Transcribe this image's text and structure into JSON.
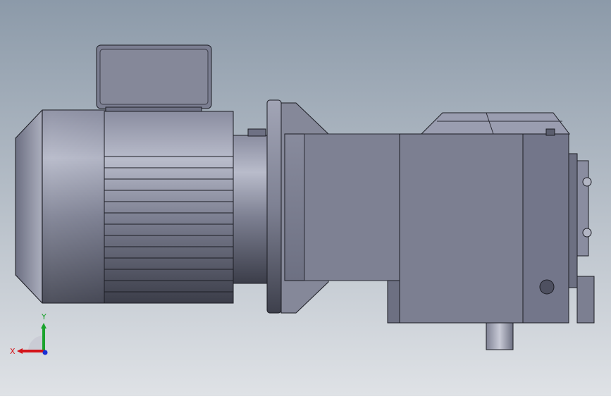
{
  "viewport": {
    "background_top": "#8c9aa9",
    "background_bottom": "#dfe2e6",
    "model_colors": {
      "body_light": "#9a9db0",
      "body_mid": "#7e8193",
      "body_dark": "#4a4c5a",
      "edge": "#1c1d24",
      "highlight": "#d9dbe6"
    }
  },
  "triad": {
    "x_label": "X",
    "y_label": "Y",
    "x_color": "#d4141a",
    "y_color": "#1aa32c",
    "z_color": "#1a2fd4"
  }
}
